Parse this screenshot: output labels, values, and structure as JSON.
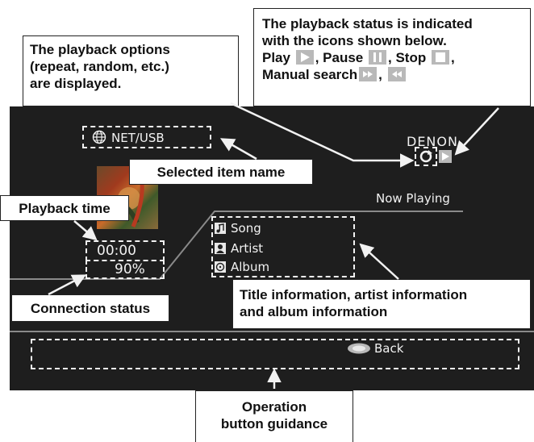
{
  "callouts": {
    "status_line1": "The playback status is indicated",
    "status_line2": "with the icons shown below.",
    "play_label": "Play",
    "pause_label": ", Pause",
    "stop_label": ", Stop",
    "stop_tail": ",",
    "manual_label": "Manual search",
    "manual_tail": ",",
    "options_line1": "The playback options",
    "options_line2": "(repeat, random, etc.)",
    "options_line3": "are displayed.",
    "selected_item": "Selected item name",
    "playback_time": "Playback time",
    "connection_status": "Connection status",
    "title_info_line1": "Title information, artist information",
    "title_info_line2": "and album information",
    "operation_line1": "Operation",
    "operation_line2": "button guidance"
  },
  "screen": {
    "source": "NET/USB",
    "brand": "DENON",
    "now_playing": "Now Playing",
    "time": "00:00",
    "connection": "90%",
    "song": "Song",
    "artist": "Artist",
    "album": "Album",
    "back": "Back"
  },
  "colors": {
    "screen_bg": "#1e1e1e",
    "screen_text": "#f2f2f2",
    "icon_gray": "#b9b9b9"
  },
  "icons": {
    "source": "globe-icon",
    "repeat": "repeat-icon",
    "play_status": "play-icon",
    "song": "music-note-icon",
    "artist": "artist-icon",
    "album": "album-icon",
    "back": "back-button-icon"
  }
}
